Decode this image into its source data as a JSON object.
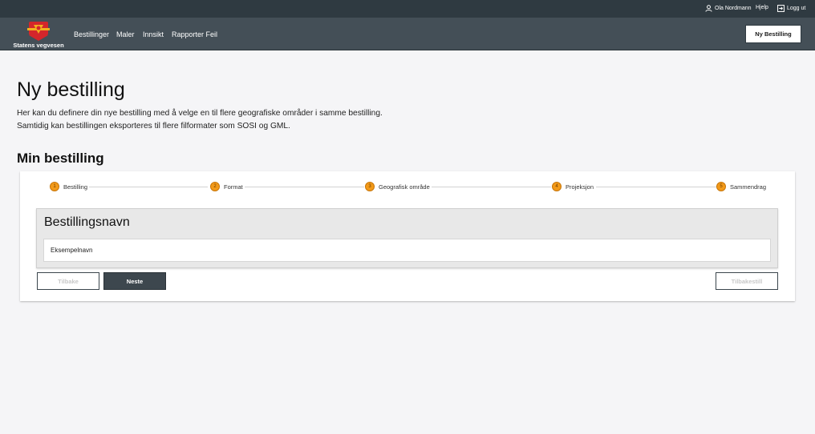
{
  "utility": {
    "user_name": "Ola Nordmann",
    "help": "Hjelp",
    "logout": "Logg ut"
  },
  "brand": {
    "name": "Statens vegvesen",
    "colors": {
      "shield_red": "#d4262b",
      "shield_gold": "#f2b01e"
    }
  },
  "nav": {
    "items": [
      {
        "label": "Bestillinger"
      },
      {
        "label": "Maler"
      },
      {
        "label": "Innsikt"
      },
      {
        "label": "Rapporter Feil"
      }
    ],
    "cta": "Ny Bestilling"
  },
  "page": {
    "title": "Ny bestilling",
    "intro_line1": "Her kan du definere din nye bestilling med å velge en til flere geografiske områder i samme bestilling.",
    "intro_line2": "Samtidig kan bestillingen eksporteres til flere filformater som SOSI og GML.",
    "section_title": "Min bestilling"
  },
  "stepper": {
    "accent": "#f39a19",
    "steps": [
      {
        "number": "1",
        "label": "Bestilling"
      },
      {
        "number": "2",
        "label": "Format"
      },
      {
        "number": "3",
        "label": "Geografisk område"
      },
      {
        "number": "4",
        "label": "Projeksjon"
      },
      {
        "number": "5",
        "label": "Sammendrag"
      }
    ]
  },
  "form": {
    "panel_title": "Bestillingsnavn",
    "name_value": "Eksempelnavn",
    "buttons": {
      "back": "Tilbake",
      "next": "Neste",
      "reset": "Tilbakestill"
    }
  }
}
